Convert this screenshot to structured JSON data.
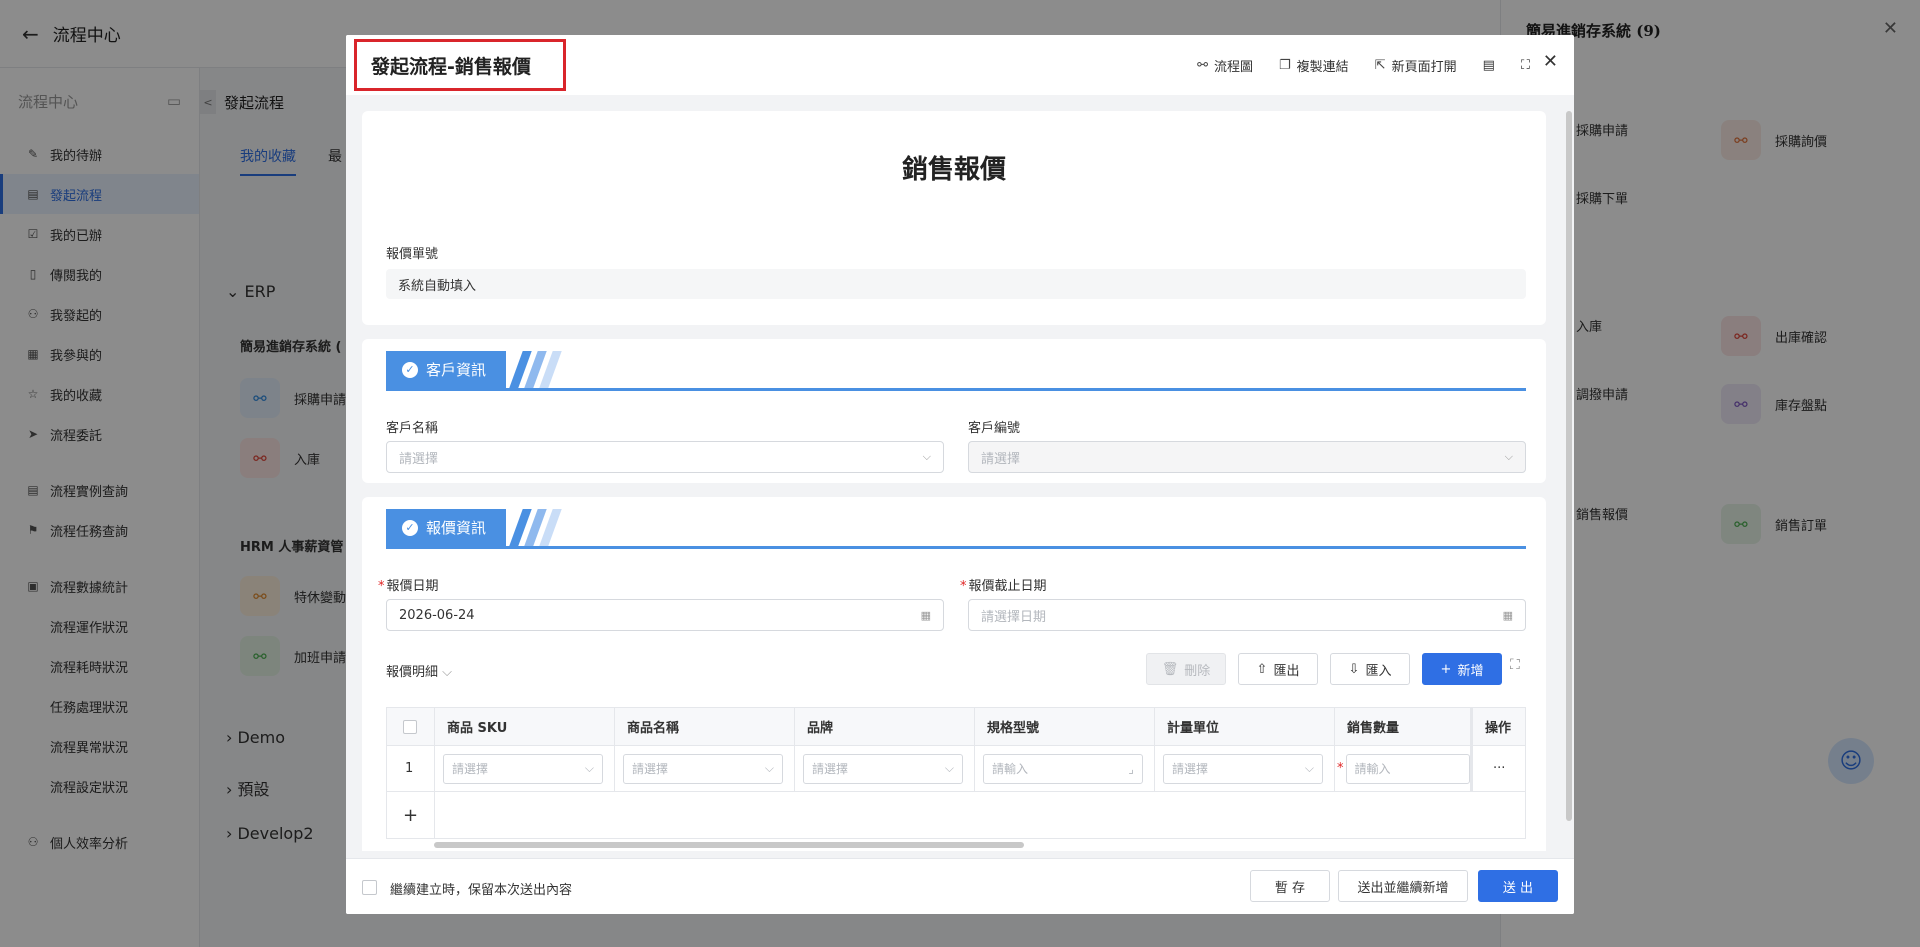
{
  "app": {
    "back_icon": "arrow-left-icon",
    "title": "流程中心"
  },
  "sidebar": {
    "header": "流程中心",
    "items": [
      {
        "label": "我的待辦",
        "icon": "✎",
        "active": false
      },
      {
        "label": "發起流程",
        "icon": "▤",
        "active": true
      },
      {
        "label": "我的已辦",
        "icon": "☑",
        "active": false
      },
      {
        "label": "傳閱我的",
        "icon": "▯",
        "active": false
      },
      {
        "label": "我發起的",
        "icon": "⚇",
        "active": false
      },
      {
        "label": "我參與的",
        "icon": "▦",
        "active": false
      },
      {
        "label": "我的收藏",
        "icon": "☆",
        "active": false
      },
      {
        "label": "流程委託",
        "icon": "➤",
        "active": false
      },
      {
        "label": "流程實例查詢",
        "icon": "▤",
        "active": false
      },
      {
        "label": "流程任務查詢",
        "icon": "⚑",
        "active": false
      },
      {
        "label": "流程數據統計",
        "icon": "▣",
        "active": false
      },
      {
        "label": "流程運作狀況",
        "icon": "",
        "active": false
      },
      {
        "label": "流程耗時狀況",
        "icon": "",
        "active": false
      },
      {
        "label": "任務處理狀況",
        "icon": "",
        "active": false
      },
      {
        "label": "流程異常狀況",
        "icon": "",
        "active": false
      },
      {
        "label": "流程設定狀況",
        "icon": "",
        "active": false
      },
      {
        "label": "個人效率分析",
        "icon": "⚇",
        "active": false
      }
    ]
  },
  "main": {
    "title": "發起流程",
    "tabs": [
      "我的收藏",
      "最"
    ],
    "groups": {
      "erp": "ERP",
      "erp_system": "簡易進銷存系統 (",
      "hrm_system": "HRM 人事薪資管",
      "demo": "Demo",
      "preset": "預設",
      "develop2": "Develop2"
    },
    "cards": [
      {
        "label": "採購申請",
        "color": "#2f8ae0"
      },
      {
        "label": "入庫",
        "color": "#e0453a"
      },
      {
        "label": "特休變動",
        "color": "#e08a2f"
      },
      {
        "label": "加班申請",
        "color": "#4caf50"
      }
    ]
  },
  "right_panel": {
    "title": "簡易進銷存系統 (9)",
    "items": [
      {
        "label": "採購申請",
        "color": ""
      },
      {
        "label": "採購詢價",
        "color": "#e0713a"
      },
      {
        "label": "採購下單",
        "color": ""
      },
      {
        "label": "入庫",
        "color": ""
      },
      {
        "label": "出庫確認",
        "color": "#e0453a"
      },
      {
        "label": "調撥申請",
        "color": ""
      },
      {
        "label": "庫存盤點",
        "color": "#7e57c2"
      },
      {
        "label": "銷售報價",
        "color": ""
      },
      {
        "label": "銷售訂單",
        "color": "#4caf50"
      }
    ]
  },
  "modal": {
    "title": "發起流程-銷售報價",
    "actions": [
      {
        "label": "流程圖",
        "icon": "⚯"
      },
      {
        "label": "複製連結",
        "icon": "❐"
      },
      {
        "label": "新頁面打開",
        "icon": "⇱"
      }
    ],
    "form_title": "銷售報價",
    "quote_no": {
      "label": "報價單號",
      "value": "系統自動填入"
    },
    "customer_section": {
      "title": "客戶資訊",
      "name_label": "客戶名稱",
      "name_placeholder": "請選擇",
      "code_label": "客戶編號",
      "code_placeholder": "請選擇"
    },
    "quote_section": {
      "title": "報價資訊",
      "date_label": "報價日期",
      "date_value": "2026-06-24",
      "deadline_label": "報價截止日期",
      "deadline_placeholder": "請選擇日期",
      "detail_label": "報價明細",
      "buttons": {
        "delete": "刪除",
        "export": "匯出",
        "import": "匯入",
        "add": "新增"
      }
    },
    "table": {
      "columns": [
        "商品 SKU",
        "商品名稱",
        "品牌",
        "規格型號",
        "計量單位",
        "銷售數量",
        "操作"
      ],
      "row_index": "1",
      "select_placeholder": "請選擇",
      "input_placeholder": "請輸入",
      "more": "···",
      "add_row": "+"
    },
    "footer": {
      "keep_label": "繼續建立時，保留本次送出內容",
      "save": "暫 存",
      "submit_continue": "送出並繼續新增",
      "submit": "送 出"
    }
  }
}
